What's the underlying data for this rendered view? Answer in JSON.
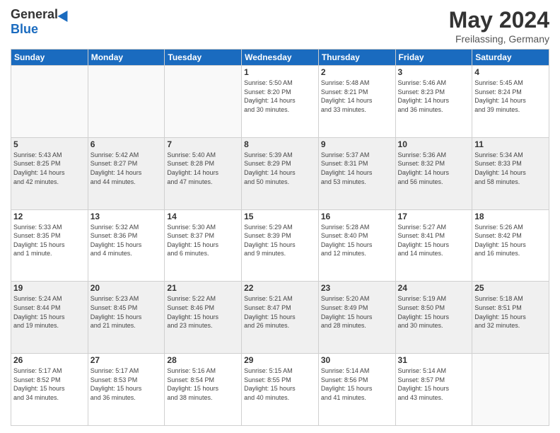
{
  "header": {
    "logo_general": "General",
    "logo_blue": "Blue",
    "month_title": "May 2024",
    "location": "Freilassing, Germany"
  },
  "days_of_week": [
    "Sunday",
    "Monday",
    "Tuesday",
    "Wednesday",
    "Thursday",
    "Friday",
    "Saturday"
  ],
  "weeks": [
    {
      "shaded": false,
      "days": [
        {
          "num": "",
          "info": ""
        },
        {
          "num": "",
          "info": ""
        },
        {
          "num": "",
          "info": ""
        },
        {
          "num": "1",
          "info": "Sunrise: 5:50 AM\nSunset: 8:20 PM\nDaylight: 14 hours\nand 30 minutes."
        },
        {
          "num": "2",
          "info": "Sunrise: 5:48 AM\nSunset: 8:21 PM\nDaylight: 14 hours\nand 33 minutes."
        },
        {
          "num": "3",
          "info": "Sunrise: 5:46 AM\nSunset: 8:23 PM\nDaylight: 14 hours\nand 36 minutes."
        },
        {
          "num": "4",
          "info": "Sunrise: 5:45 AM\nSunset: 8:24 PM\nDaylight: 14 hours\nand 39 minutes."
        }
      ]
    },
    {
      "shaded": true,
      "days": [
        {
          "num": "5",
          "info": "Sunrise: 5:43 AM\nSunset: 8:25 PM\nDaylight: 14 hours\nand 42 minutes."
        },
        {
          "num": "6",
          "info": "Sunrise: 5:42 AM\nSunset: 8:27 PM\nDaylight: 14 hours\nand 44 minutes."
        },
        {
          "num": "7",
          "info": "Sunrise: 5:40 AM\nSunset: 8:28 PM\nDaylight: 14 hours\nand 47 minutes."
        },
        {
          "num": "8",
          "info": "Sunrise: 5:39 AM\nSunset: 8:29 PM\nDaylight: 14 hours\nand 50 minutes."
        },
        {
          "num": "9",
          "info": "Sunrise: 5:37 AM\nSunset: 8:31 PM\nDaylight: 14 hours\nand 53 minutes."
        },
        {
          "num": "10",
          "info": "Sunrise: 5:36 AM\nSunset: 8:32 PM\nDaylight: 14 hours\nand 56 minutes."
        },
        {
          "num": "11",
          "info": "Sunrise: 5:34 AM\nSunset: 8:33 PM\nDaylight: 14 hours\nand 58 minutes."
        }
      ]
    },
    {
      "shaded": false,
      "days": [
        {
          "num": "12",
          "info": "Sunrise: 5:33 AM\nSunset: 8:35 PM\nDaylight: 15 hours\nand 1 minute."
        },
        {
          "num": "13",
          "info": "Sunrise: 5:32 AM\nSunset: 8:36 PM\nDaylight: 15 hours\nand 4 minutes."
        },
        {
          "num": "14",
          "info": "Sunrise: 5:30 AM\nSunset: 8:37 PM\nDaylight: 15 hours\nand 6 minutes."
        },
        {
          "num": "15",
          "info": "Sunrise: 5:29 AM\nSunset: 8:39 PM\nDaylight: 15 hours\nand 9 minutes."
        },
        {
          "num": "16",
          "info": "Sunrise: 5:28 AM\nSunset: 8:40 PM\nDaylight: 15 hours\nand 12 minutes."
        },
        {
          "num": "17",
          "info": "Sunrise: 5:27 AM\nSunset: 8:41 PM\nDaylight: 15 hours\nand 14 minutes."
        },
        {
          "num": "18",
          "info": "Sunrise: 5:26 AM\nSunset: 8:42 PM\nDaylight: 15 hours\nand 16 minutes."
        }
      ]
    },
    {
      "shaded": true,
      "days": [
        {
          "num": "19",
          "info": "Sunrise: 5:24 AM\nSunset: 8:44 PM\nDaylight: 15 hours\nand 19 minutes."
        },
        {
          "num": "20",
          "info": "Sunrise: 5:23 AM\nSunset: 8:45 PM\nDaylight: 15 hours\nand 21 minutes."
        },
        {
          "num": "21",
          "info": "Sunrise: 5:22 AM\nSunset: 8:46 PM\nDaylight: 15 hours\nand 23 minutes."
        },
        {
          "num": "22",
          "info": "Sunrise: 5:21 AM\nSunset: 8:47 PM\nDaylight: 15 hours\nand 26 minutes."
        },
        {
          "num": "23",
          "info": "Sunrise: 5:20 AM\nSunset: 8:49 PM\nDaylight: 15 hours\nand 28 minutes."
        },
        {
          "num": "24",
          "info": "Sunrise: 5:19 AM\nSunset: 8:50 PM\nDaylight: 15 hours\nand 30 minutes."
        },
        {
          "num": "25",
          "info": "Sunrise: 5:18 AM\nSunset: 8:51 PM\nDaylight: 15 hours\nand 32 minutes."
        }
      ]
    },
    {
      "shaded": false,
      "days": [
        {
          "num": "26",
          "info": "Sunrise: 5:17 AM\nSunset: 8:52 PM\nDaylight: 15 hours\nand 34 minutes."
        },
        {
          "num": "27",
          "info": "Sunrise: 5:17 AM\nSunset: 8:53 PM\nDaylight: 15 hours\nand 36 minutes."
        },
        {
          "num": "28",
          "info": "Sunrise: 5:16 AM\nSunset: 8:54 PM\nDaylight: 15 hours\nand 38 minutes."
        },
        {
          "num": "29",
          "info": "Sunrise: 5:15 AM\nSunset: 8:55 PM\nDaylight: 15 hours\nand 40 minutes."
        },
        {
          "num": "30",
          "info": "Sunrise: 5:14 AM\nSunset: 8:56 PM\nDaylight: 15 hours\nand 41 minutes."
        },
        {
          "num": "31",
          "info": "Sunrise: 5:14 AM\nSunset: 8:57 PM\nDaylight: 15 hours\nand 43 minutes."
        },
        {
          "num": "",
          "info": ""
        }
      ]
    }
  ]
}
